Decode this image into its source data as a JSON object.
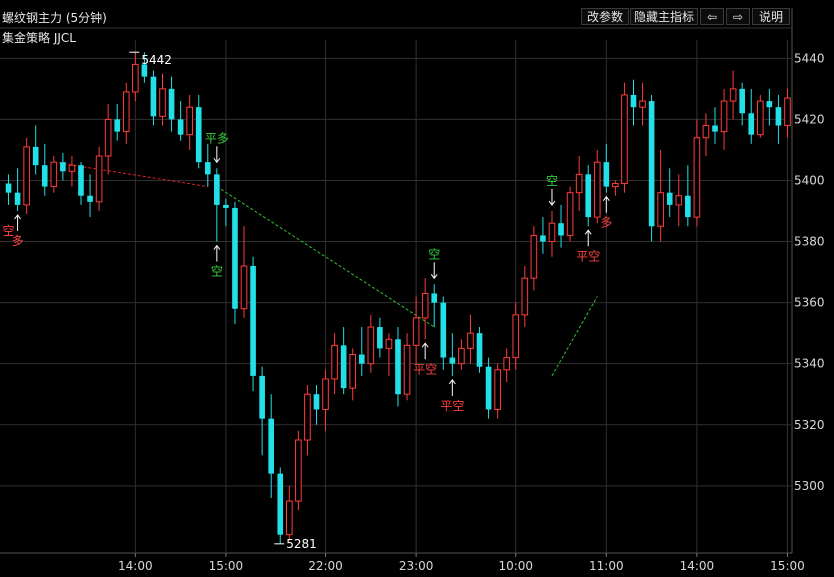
{
  "header": {
    "title": "螺纹钢主力 (5分钟)",
    "subtitle": "集金策略 JJCL",
    "buttons": {
      "params": "改参数",
      "hide_indicator": "隐藏主指标",
      "prev": "⇦",
      "next": "⇨",
      "help": "说明"
    }
  },
  "colors": {
    "background": "#000000",
    "up": "#ff3b3b",
    "down": "#22e0e8",
    "grid": "#303030",
    "long_signal": "#ff4040",
    "short_signal": "#35d23a",
    "trend_red": "#e02020",
    "trend_green": "#30c030"
  },
  "chart_data": {
    "type": "candlestick",
    "title": "螺纹钢主力 (5分钟)",
    "ylim": [
      5280,
      5450
    ],
    "y_ticks": [
      5300,
      5320,
      5340,
      5360,
      5380,
      5400,
      5420,
      5440
    ],
    "x_ticks": [
      {
        "label": "14:00",
        "bar": 14
      },
      {
        "label": "15:00",
        "bar": 24
      },
      {
        "label": "22:00",
        "bar": 35
      },
      {
        "label": "23:00",
        "bar": 45
      },
      {
        "label": "10:00",
        "bar": 56
      },
      {
        "label": "11:00",
        "bar": 66
      },
      {
        "label": "14:00",
        "bar": 76
      },
      {
        "label": "15:00",
        "bar": 86
      }
    ],
    "grid": true,
    "candles": [
      [
        5399,
        5402,
        5392,
        5396
      ],
      [
        5396,
        5404,
        5390,
        5392
      ],
      [
        5392,
        5414,
        5389,
        5411
      ],
      [
        5411,
        5418,
        5402,
        5405
      ],
      [
        5405,
        5412,
        5395,
        5398
      ],
      [
        5398,
        5408,
        5396,
        5406
      ],
      [
        5406,
        5409,
        5400,
        5403
      ],
      [
        5403,
        5408,
        5398,
        5405
      ],
      [
        5405,
        5406,
        5392,
        5395
      ],
      [
        5395,
        5402,
        5388,
        5393
      ],
      [
        5393,
        5411,
        5390,
        5408
      ],
      [
        5408,
        5425,
        5402,
        5420
      ],
      [
        5420,
        5425,
        5413,
        5416
      ],
      [
        5416,
        5432,
        5412,
        5429
      ],
      [
        5429,
        5442,
        5426,
        5438
      ],
      [
        5438,
        5442,
        5432,
        5434
      ],
      [
        5434,
        5436,
        5418,
        5421
      ],
      [
        5421,
        5435,
        5418,
        5430
      ],
      [
        5430,
        5434,
        5416,
        5420
      ],
      [
        5420,
        5426,
        5413,
        5415
      ],
      [
        5415,
        5428,
        5410,
        5424
      ],
      [
        5424,
        5428,
        5404,
        5406
      ],
      [
        5406,
        5412,
        5398,
        5402
      ],
      [
        5402,
        5404,
        5380,
        5392
      ],
      [
        5392,
        5394,
        5385,
        5391
      ],
      [
        5391,
        5393,
        5353,
        5358
      ],
      [
        5358,
        5385,
        5355,
        5372
      ],
      [
        5372,
        5375,
        5331,
        5336
      ],
      [
        5336,
        5339,
        5310,
        5322
      ],
      [
        5322,
        5330,
        5296,
        5304
      ],
      [
        5304,
        5306,
        5281,
        5284
      ],
      [
        5284,
        5300,
        5282,
        5295
      ],
      [
        5295,
        5318,
        5292,
        5315
      ],
      [
        5315,
        5333,
        5310,
        5330
      ],
      [
        5330,
        5333,
        5320,
        5325
      ],
      [
        5325,
        5338,
        5318,
        5335
      ],
      [
        5335,
        5350,
        5330,
        5346
      ],
      [
        5346,
        5352,
        5330,
        5332
      ],
      [
        5332,
        5345,
        5328,
        5343
      ],
      [
        5343,
        5352,
        5336,
        5340
      ],
      [
        5340,
        5356,
        5337,
        5352
      ],
      [
        5352,
        5355,
        5342,
        5345
      ],
      [
        5345,
        5350,
        5336,
        5348
      ],
      [
        5348,
        5352,
        5326,
        5330
      ],
      [
        5330,
        5350,
        5328,
        5346
      ],
      [
        5346,
        5362,
        5340,
        5355
      ],
      [
        5355,
        5368,
        5348,
        5363
      ],
      [
        5363,
        5366,
        5352,
        5360
      ],
      [
        5360,
        5362,
        5338,
        5342
      ],
      [
        5342,
        5350,
        5336,
        5340
      ],
      [
        5340,
        5348,
        5338,
        5345
      ],
      [
        5345,
        5356,
        5340,
        5350
      ],
      [
        5350,
        5352,
        5337,
        5339
      ],
      [
        5339,
        5342,
        5322,
        5325
      ],
      [
        5325,
        5340,
        5322,
        5338
      ],
      [
        5338,
        5345,
        5334,
        5342
      ],
      [
        5342,
        5360,
        5338,
        5356
      ],
      [
        5356,
        5372,
        5352,
        5368
      ],
      [
        5368,
        5385,
        5364,
        5382
      ],
      [
        5382,
        5388,
        5376,
        5380
      ],
      [
        5380,
        5390,
        5375,
        5386
      ],
      [
        5386,
        5392,
        5378,
        5382
      ],
      [
        5382,
        5398,
        5380,
        5396
      ],
      [
        5396,
        5408,
        5390,
        5402
      ],
      [
        5402,
        5405,
        5385,
        5388
      ],
      [
        5388,
        5410,
        5386,
        5406
      ],
      [
        5406,
        5412,
        5396,
        5398
      ],
      [
        5398,
        5400,
        5395,
        5399
      ],
      [
        5399,
        5432,
        5396,
        5428
      ],
      [
        5428,
        5433,
        5418,
        5424
      ],
      [
        5424,
        5432,
        5418,
        5426
      ],
      [
        5426,
        5428,
        5380,
        5385
      ],
      [
        5385,
        5410,
        5380,
        5396
      ],
      [
        5396,
        5404,
        5388,
        5392
      ],
      [
        5392,
        5402,
        5385,
        5395
      ],
      [
        5395,
        5405,
        5385,
        5388
      ],
      [
        5388,
        5420,
        5385,
        5414
      ],
      [
        5414,
        5422,
        5408,
        5418
      ],
      [
        5418,
        5424,
        5412,
        5416
      ],
      [
        5416,
        5430,
        5410,
        5426
      ],
      [
        5426,
        5436,
        5420,
        5430
      ],
      [
        5430,
        5432,
        5418,
        5422
      ],
      [
        5422,
        5430,
        5412,
        5415
      ],
      [
        5415,
        5428,
        5414,
        5426
      ],
      [
        5426,
        5430,
        5418,
        5424
      ],
      [
        5424,
        5428,
        5412,
        5418
      ],
      [
        5418,
        5430,
        5414,
        5427
      ]
    ],
    "annotations": [
      {
        "text": "5442",
        "bar": 14,
        "price": 5442
      },
      {
        "text": "5281",
        "bar": 30,
        "price": 5281
      }
    ],
    "signals": [
      {
        "bar": 1,
        "text": "多",
        "kind": "long"
      },
      {
        "bar": 0,
        "text": "空",
        "kind": "long_label"
      },
      {
        "bar": 23,
        "text": "平多",
        "kind": "exit_long"
      },
      {
        "bar": 23,
        "text": "空",
        "kind": "short"
      },
      {
        "bar": 47,
        "text": "空",
        "kind": "short"
      },
      {
        "bar": 46,
        "text": "平空",
        "kind": "exit_short"
      },
      {
        "bar": 49,
        "text": "平空",
        "kind": "exit_short"
      },
      {
        "bar": 60,
        "text": "空",
        "kind": "short"
      },
      {
        "bar": 64,
        "text": "平空",
        "kind": "exit_short"
      },
      {
        "bar": 66,
        "text": "多",
        "kind": "long"
      }
    ],
    "trend_lines": [
      {
        "color": "red",
        "points": [
          [
            5,
            5406
          ],
          [
            22,
            5398
          ]
        ]
      },
      {
        "color": "green",
        "points": [
          [
            23,
            5398
          ],
          [
            47,
            5352
          ]
        ]
      },
      {
        "color": "green",
        "points": [
          [
            60,
            5336
          ],
          [
            65,
            5362
          ]
        ]
      }
    ]
  }
}
